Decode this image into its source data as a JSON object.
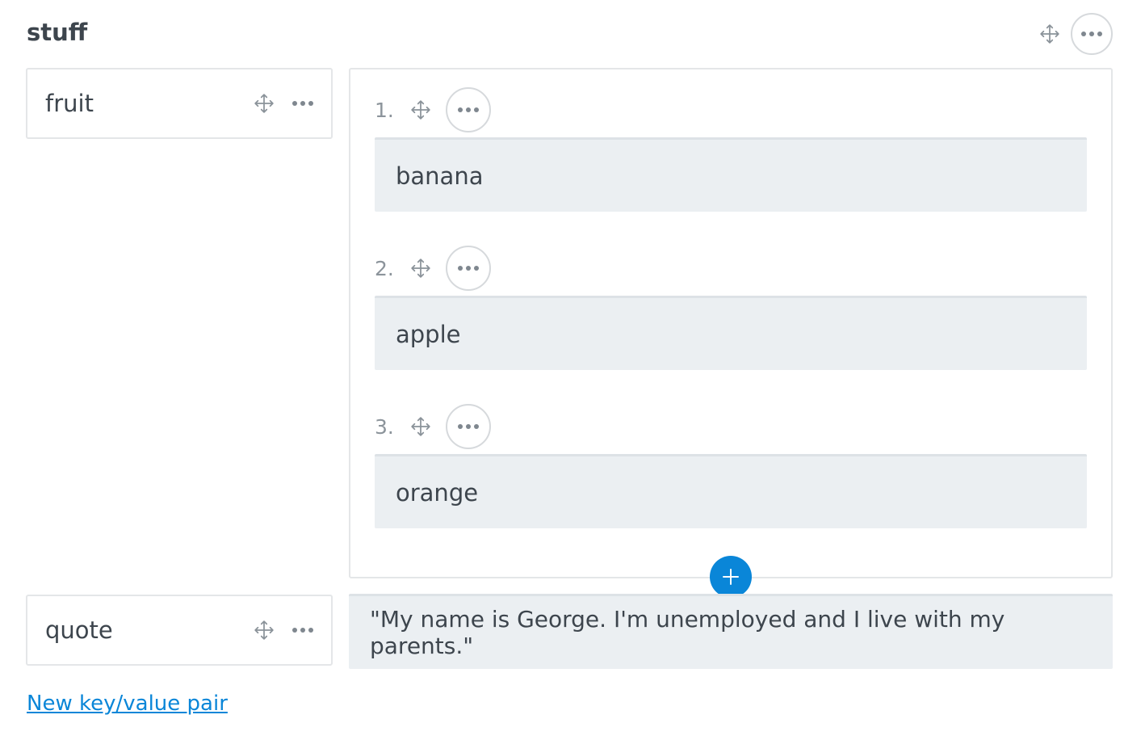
{
  "object": {
    "title": "stuff",
    "icons": {
      "move": "move-icon",
      "more": "more-icon"
    }
  },
  "pairs": [
    {
      "key": "fruit",
      "type": "array",
      "items": [
        {
          "number": "1.",
          "value": "banana"
        },
        {
          "number": "2.",
          "value": "apple"
        },
        {
          "number": "3.",
          "value": "orange"
        }
      ],
      "add_icon": "plus-icon"
    },
    {
      "key": "quote",
      "type": "string",
      "value": "\"My name is George. I'm unemployed and I live with my parents.\""
    }
  ],
  "new_pair_link": "New key/value pair",
  "colors": {
    "accent": "#0a86d8",
    "value_bg": "#ebeff2",
    "border": "#e4e6e8",
    "text": "#3d454d",
    "muted": "#8c949b"
  }
}
